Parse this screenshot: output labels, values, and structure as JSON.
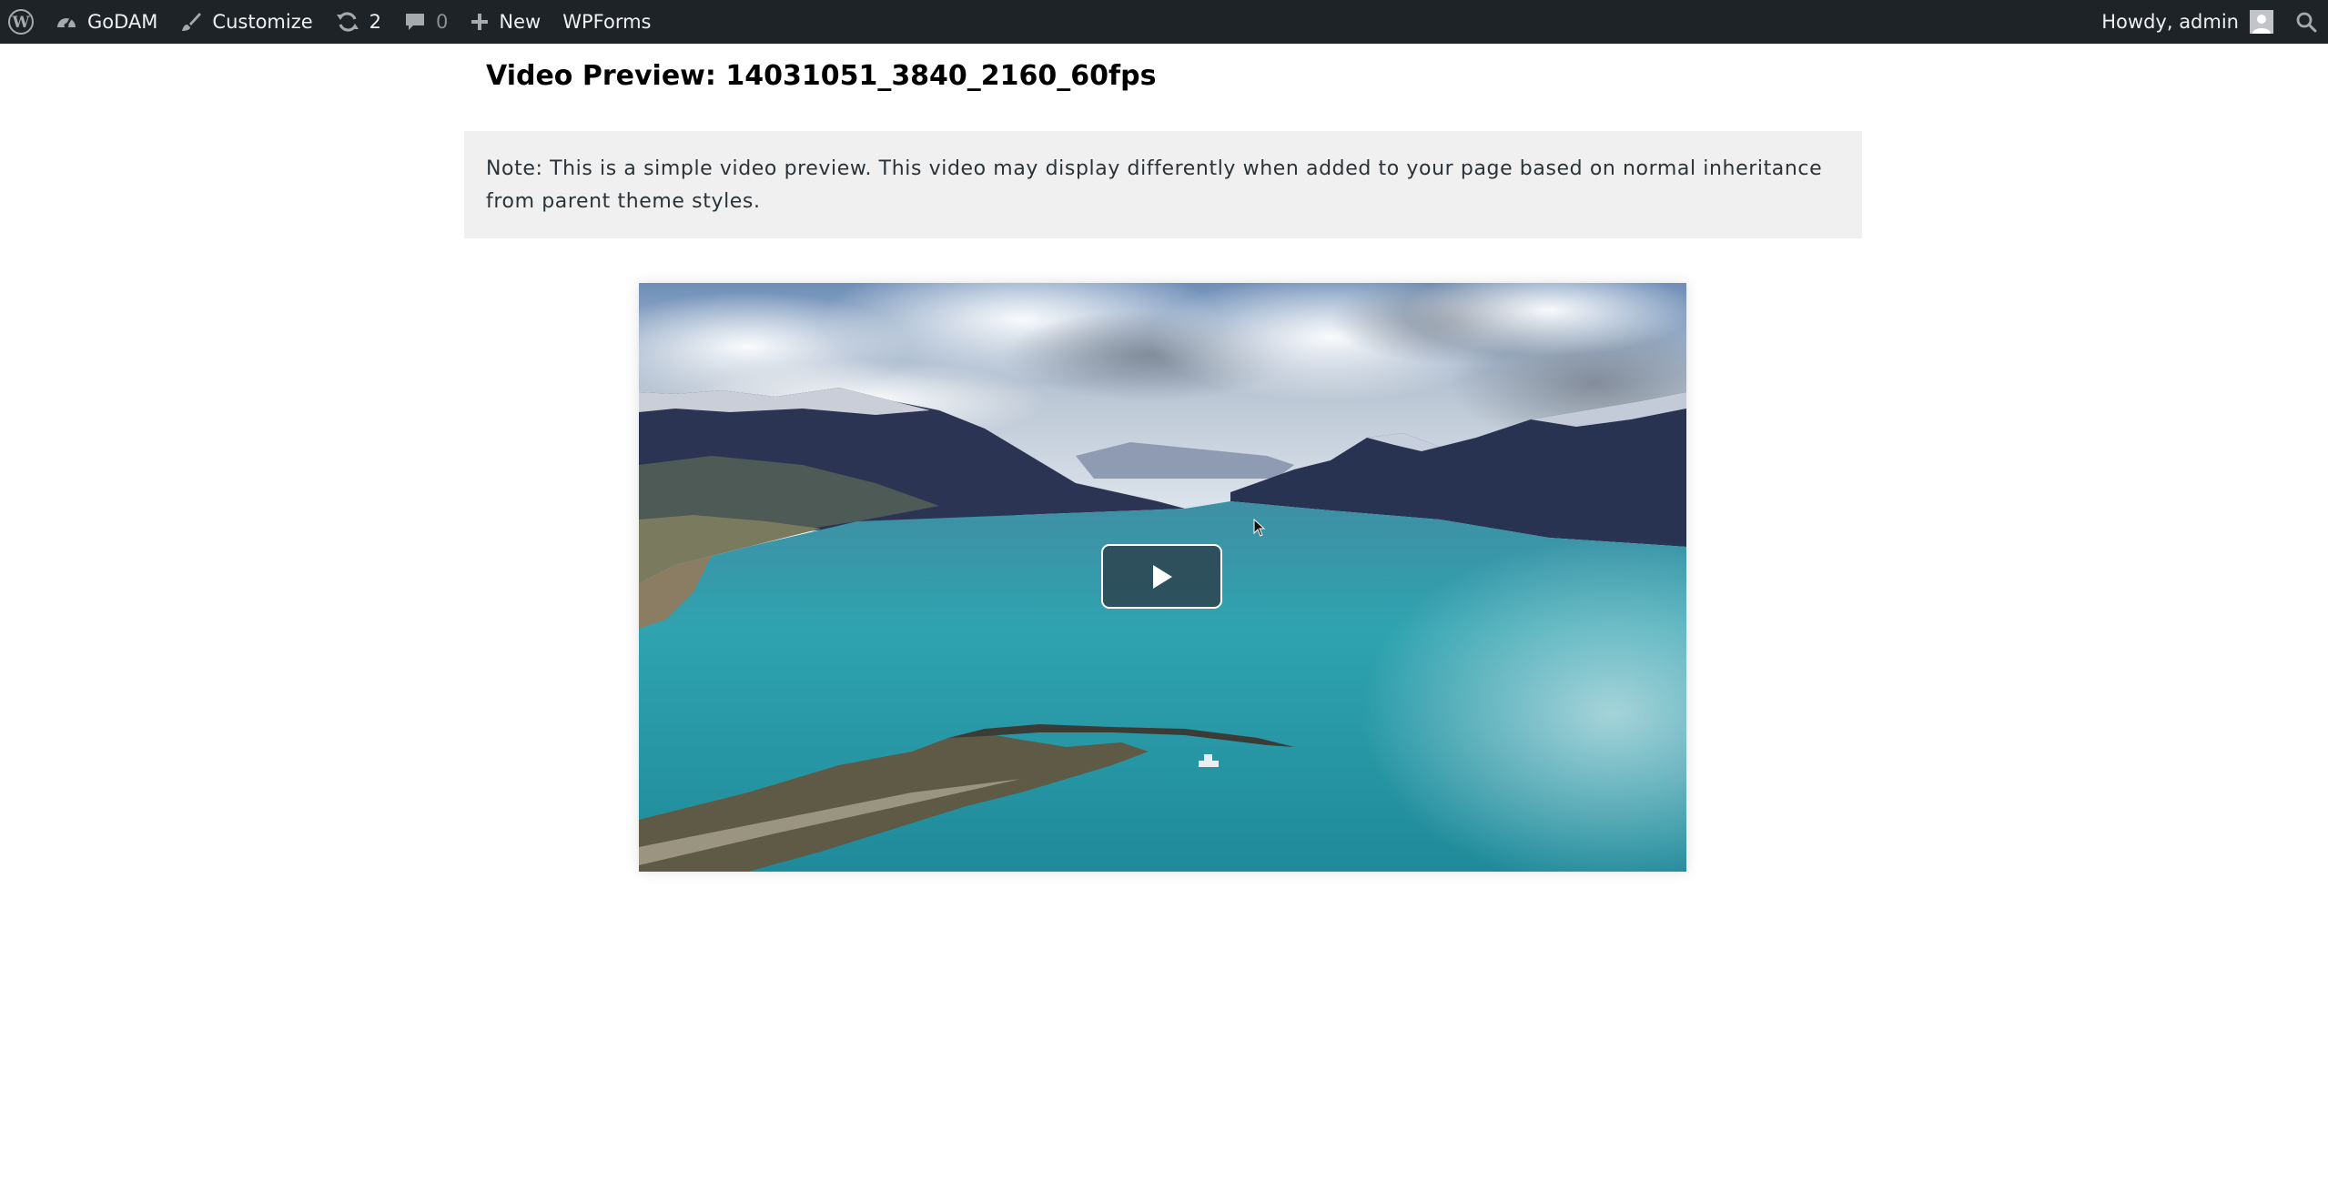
{
  "admin_bar": {
    "left": [
      {
        "icon": "wordpress-logo-icon",
        "label": ""
      },
      {
        "icon": "dashboard-icon",
        "label": "GoDAM"
      },
      {
        "icon": "paintbrush-icon",
        "label": "Customize"
      },
      {
        "icon": "updates-icon",
        "label": "2"
      },
      {
        "icon": "comments-icon",
        "label": "0"
      },
      {
        "icon": "plus-icon",
        "label": "New"
      },
      {
        "icon": "",
        "label": "WPForms"
      }
    ],
    "greeting": "Howdy, admin",
    "search_icon": "search-icon",
    "background": "#1d2327"
  },
  "page": {
    "title": "Video Preview: 14031051_3840_2160_60fps",
    "note": "Note: This is a simple video preview. This video may display differently when added to your page based on normal inheritance from parent theme styles."
  },
  "video": {
    "thumbnail": "aerial view of a turquoise glacial lake between mountains under a cloudy sky",
    "play_icon": "play-icon",
    "state": "paused"
  }
}
